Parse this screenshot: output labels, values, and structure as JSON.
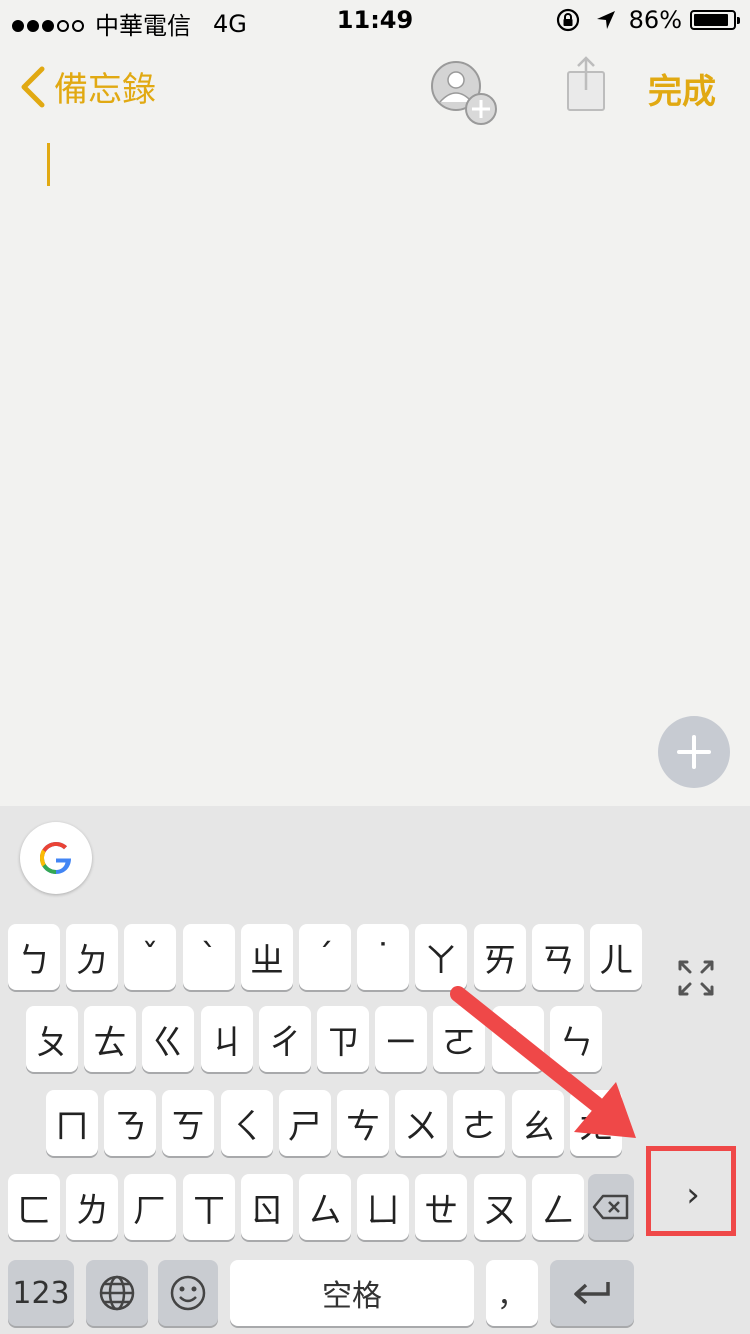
{
  "status": {
    "signal_dots": [
      true,
      true,
      true,
      false,
      false
    ],
    "carrier": "中華電信",
    "network": "4G",
    "time": "11:49",
    "battery": "86%",
    "battery_level": 0.86
  },
  "nav": {
    "back_label": "備忘錄",
    "done_label": "完成"
  },
  "colors": {
    "accent": "#e1a912",
    "annotation": "#ef4848"
  },
  "keyboard": {
    "rows": [
      [
        "ㄅ",
        "ㄉ",
        "ˇ",
        "ˋ",
        "ㄓ",
        "ˊ",
        "˙",
        "ㄚ",
        "ㄞ",
        "ㄢ",
        "ㄦ"
      ],
      [
        "ㄆ",
        "ㄊ",
        "ㄍ",
        "ㄐ",
        "ㄔ",
        "ㄗ",
        "ㄧ",
        "ㄛ",
        "ㄟ",
        "ㄣ"
      ],
      [
        "ㄇ",
        "ㄋ",
        "ㄎ",
        "ㄑ",
        "ㄕ",
        "ㄘ",
        "ㄨ",
        "ㄜ",
        "ㄠ",
        "ㄤ"
      ],
      [
        "ㄈ",
        "ㄌ",
        "ㄏ",
        "ㄒ",
        "ㄖ",
        "ㄙ",
        "ㄩ",
        "ㄝ",
        "ㄡ",
        "ㄥ"
      ]
    ],
    "num_label": "123",
    "space_label": "空格",
    "comma_label": "，",
    "next_label": "›"
  }
}
